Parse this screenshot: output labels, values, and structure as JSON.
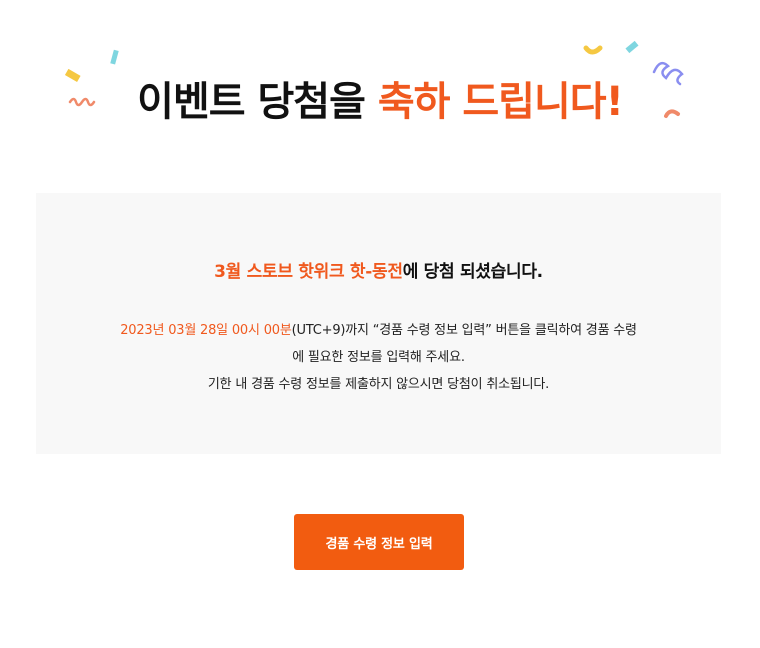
{
  "headline": {
    "text_plain": "이벤트 당첨을",
    "text_accent": "축하 드립니다!"
  },
  "panel": {
    "subtitle_accent": "3월 스토브 핫위크 핫-동전",
    "subtitle_rest": "에 당첨 되셨습니다.",
    "deadline": "2023년 03월 28일 00시 00분",
    "line1_rest": "(UTC+9)까지 “경품 수령 정보 입력” 버튼을 클릭하여 경품 수령",
    "line2": "에 필요한 정보를 입력해 주세요.",
    "line3": "기한 내 경품 수령 정보를 제출하지 않으시면 당첨이 취소됩니다."
  },
  "button": {
    "label": "경품 수령 정보 입력"
  },
  "colors": {
    "accent": "#f0591e",
    "button": "#f25c10",
    "panel_bg": "#f8f8f8"
  }
}
